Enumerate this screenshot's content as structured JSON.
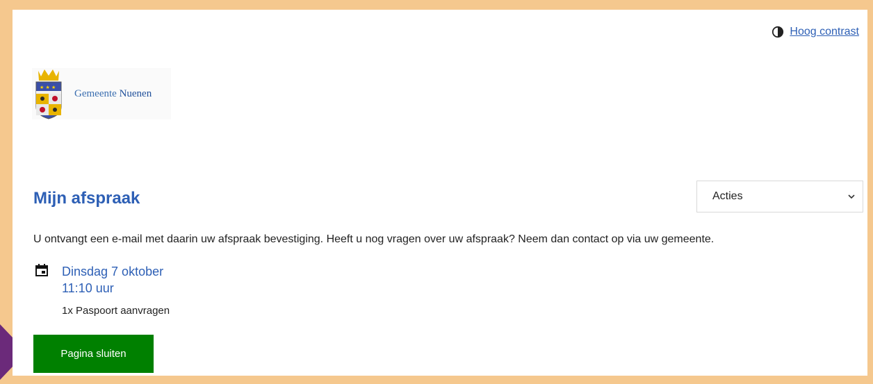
{
  "header": {
    "contrast_label": "Hoog contrast",
    "logo_prefix": "Gemeente",
    "logo_name": "Nuenen"
  },
  "main": {
    "title": "Mijn afspraak",
    "actions_select": {
      "selected": "Acties"
    },
    "intro": "U ontvangt een e-mail met daarin uw afspraak bevestiging. Heeft u nog vragen over uw afspraak? Neem dan contact op via uw gemeente.",
    "appointment": {
      "date": "Dinsdag 7 oktober",
      "time": "11:10 uur",
      "product": "1x Paspoort aanvragen"
    },
    "close_label": "Pagina sluiten"
  },
  "icons": [
    "contrast-icon",
    "calendar-icon",
    "chevron-down-icon"
  ],
  "colors": {
    "accent": "#2d5fb5",
    "button": "#008000",
    "frame": "#f5c88e",
    "pointer": "#6b2a7a"
  }
}
